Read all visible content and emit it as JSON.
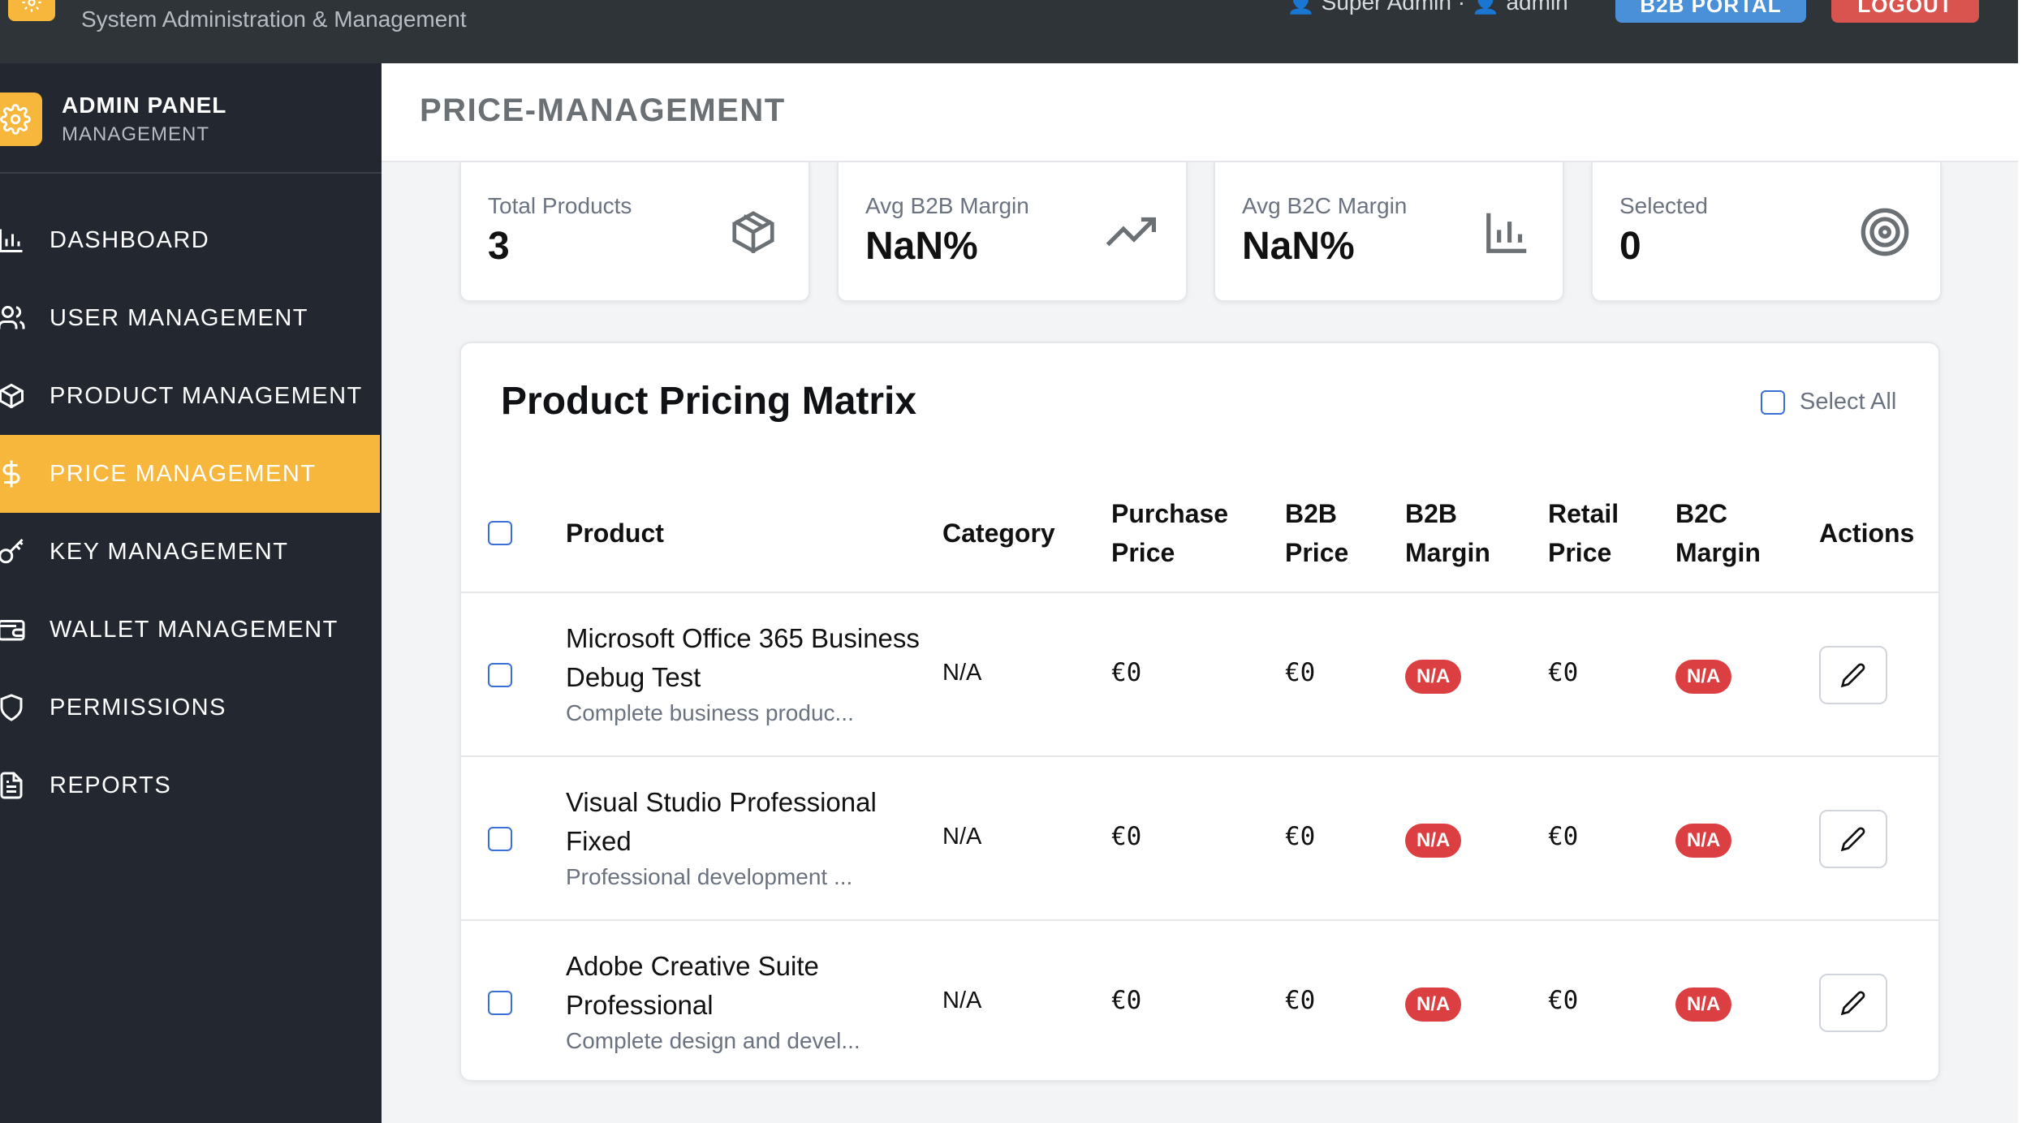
{
  "header": {
    "subtitle": "System Administration & Management",
    "user_info": "👤 Super Admin · 👤 admin",
    "portal_button": "B2B PORTAL",
    "logout_button": "LOGOUT"
  },
  "sidebar": {
    "brand_title": "ADMIN PANEL",
    "brand_subtitle": "MANAGEMENT",
    "items": [
      {
        "label": "DASHBOARD",
        "icon": "bar-chart-icon",
        "active": false
      },
      {
        "label": "USER MANAGEMENT",
        "icon": "users-icon",
        "active": false
      },
      {
        "label": "PRODUCT MANAGEMENT",
        "icon": "box-icon",
        "active": false
      },
      {
        "label": "PRICE MANAGEMENT",
        "icon": "dollar-icon",
        "active": true
      },
      {
        "label": "KEY MANAGEMENT",
        "icon": "key-icon",
        "active": false
      },
      {
        "label": "WALLET MANAGEMENT",
        "icon": "wallet-icon",
        "active": false
      },
      {
        "label": "PERMISSIONS",
        "icon": "shield-icon",
        "active": false
      },
      {
        "label": "REPORTS",
        "icon": "file-text-icon",
        "active": false
      }
    ]
  },
  "page": {
    "title": "PRICE-MANAGEMENT"
  },
  "stats": [
    {
      "label": "Total Products",
      "value": "3",
      "icon": "box-icon"
    },
    {
      "label": "Avg B2B Margin",
      "value": "NaN%",
      "icon": "trending-up-icon"
    },
    {
      "label": "Avg B2C Margin",
      "value": "NaN%",
      "icon": "bar-chart-icon"
    },
    {
      "label": "Selected",
      "value": "0",
      "icon": "target-icon"
    }
  ],
  "table": {
    "title": "Product Pricing Matrix",
    "select_all_label": "Select All",
    "columns": {
      "product": "Product",
      "category": "Category",
      "purchase_price": [
        "Purchase",
        "Price"
      ],
      "b2b_price": [
        "B2B",
        "Price"
      ],
      "b2b_margin": [
        "B2B",
        "Margin"
      ],
      "retail_price": [
        "Retail",
        "Price"
      ],
      "b2c_margin": [
        "B2C",
        "Margin"
      ],
      "actions": "Actions"
    },
    "rows": [
      {
        "name": "Microsoft Office 365 Business Debug Test",
        "desc": "Complete business produc...",
        "category": "N/A",
        "purchase_price": "€0",
        "b2b_price": "€0",
        "b2b_margin": "N/A",
        "retail_price": "€0",
        "b2c_margin": "N/A"
      },
      {
        "name": "Visual Studio Professional Fixed",
        "desc": "Professional development ...",
        "category": "N/A",
        "purchase_price": "€0",
        "b2b_price": "€0",
        "b2b_margin": "N/A",
        "retail_price": "€0",
        "b2c_margin": "N/A"
      },
      {
        "name": "Adobe Creative Suite Professional",
        "desc": "Complete design and devel...",
        "category": "N/A",
        "purchase_price": "€0",
        "b2b_price": "€0",
        "b2b_margin": "N/A",
        "retail_price": "€0",
        "b2c_margin": "N/A"
      }
    ]
  },
  "colors": {
    "sidebar_bg": "#232830",
    "accent": "#f6b73c",
    "badge_red": "#dc3f41",
    "checkbox_blue": "#3b6fd8"
  }
}
